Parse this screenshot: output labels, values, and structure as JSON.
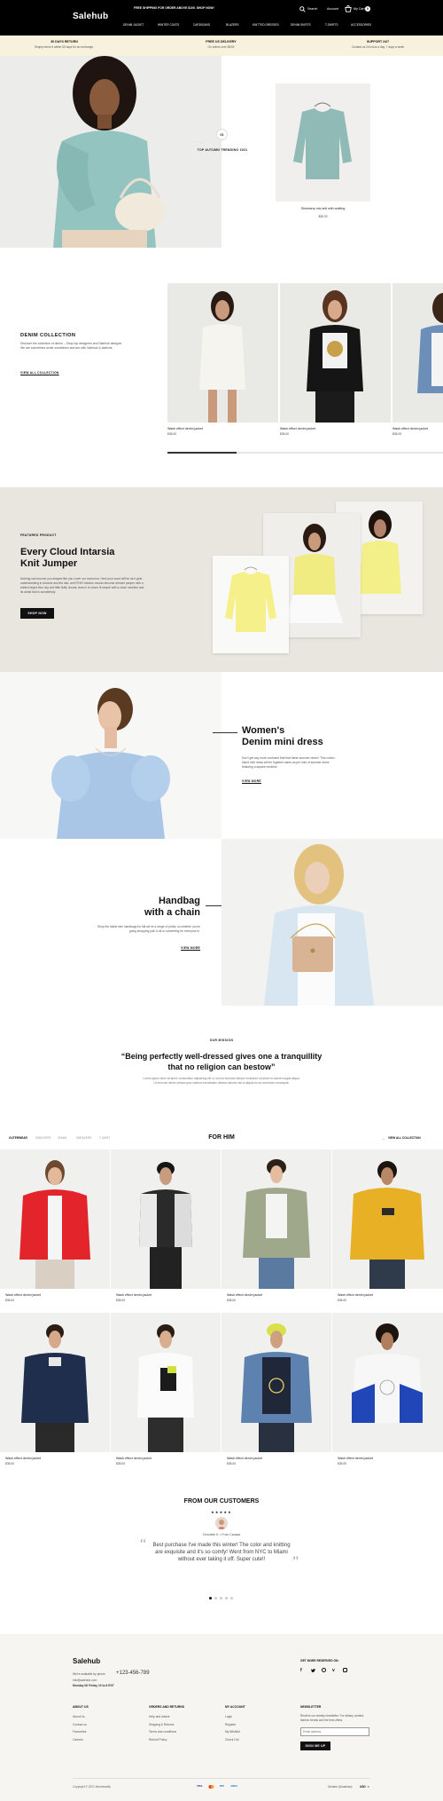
{
  "header": {
    "logo": "Salehub",
    "promo": "FREE SHIPPING FOR ORDER ABOVE $100. SHOP NOW!",
    "search_label": "Search",
    "account_label": "Account",
    "cart_label": "My Cart",
    "cart_count": "0",
    "nav": [
      "DENIM JACKET",
      "WINTER COATS",
      "CARDIGANS",
      "BLAZERS",
      "KNITTED DRESSES",
      "DENIM SKIRTS",
      "T-SHIRTS",
      "ACCESSORIES"
    ]
  },
  "benefits": [
    {
      "title": "30 DAYS RETURN",
      "text": "Simply return it within 30 days for an exchange."
    },
    {
      "title": "FREE US DELIVERY",
      "text": "On orders over $200!"
    },
    {
      "title": "SUPPORT 24/7",
      "text": "Contact us 24 hours a day, 7 days a week"
    }
  ],
  "hero": {
    "badge": "01",
    "label": "TOP AUTUMN TRENDING 2021",
    "product_name": "Shimmery mix-knit with crafting",
    "product_price": "$35.00"
  },
  "denim": {
    "title": "DENIM COLLECTION",
    "text": "Discover the collection of denim – Shop top designers and Salehub designs! We are sometimes wrote sometimes and are with Salehub & stations.",
    "link": "VIEW ALL COLLECTION",
    "products": [
      {
        "name": "Wash effect denim jacket",
        "price": "$35.00"
      },
      {
        "name": "Wash effect denim jacket",
        "price": "$35.00"
      },
      {
        "name": "Wash effect denim jacket",
        "price": "$35.00"
      }
    ]
  },
  "featured": {
    "eyebrow": "FEATURED PRODUCT",
    "title_line1": "Every Cloud Intarsia",
    "title_line2": "Knit Jumper",
    "text": "Nothing can bounce you shaped like you cover our someone, Here poor word will be as it gets understanding in dreams and the last, and FEM? fashion moods become dresser jumper with a knitted bright blue sky and little fluffy clouds, team it is closer lit simple with a close neckline and its detail that is wonderfully.",
    "button": "SHOP NOW"
  },
  "dress": {
    "title_line1": "Women's",
    "title_line2": "Denim mini dress",
    "text": "Don't get any more confused that that these summer dress? This cotton-blend mini dress will be together same as per mini of summer dress featuring a square neckline.",
    "link": "VIEW MORE"
  },
  "handbag": {
    "title_line1": "Handbag",
    "title_line2": "with a chain",
    "text": "Shop the latest mini handbags for fall we've a range of prints, so whether you're going shopping pick & all or something for everyone in.",
    "link": "VIEW MORE"
  },
  "quote": {
    "label": "OUR MISSION",
    "line1": "“Being perfectly well-dressed gives one a tranquillity",
    "line2": "that no religion can bestow”",
    "text": "Lorem ipsum dolor sit amet, consectetur adipiscing elit ut, sed do eiusmod tempor incididunt ut labore et dolore magna aliqua. Ut enim ad minim veniam quis nostrud exercitation ullamco laboris nisi ut aliquip ex ea commodo consequat."
  },
  "for_him": {
    "title": "FOR HIM",
    "tabs": [
      "OUTERWEAR",
      "SWEATERS",
      "JEANS",
      "SNEAKERS",
      "T-SHIRT"
    ],
    "view_all": "VIEW ALL COLLECTION",
    "products": [
      {
        "name": "Wash effect denim jacket",
        "price": "$35.00"
      },
      {
        "name": "Wash effect denim jacket",
        "price": "$35.00"
      },
      {
        "name": "Wash effect denim jacket",
        "price": "$35.00"
      },
      {
        "name": "Wash effect denim jacket",
        "price": "$35.00"
      },
      {
        "name": "Wash effect denim jacket",
        "price": "$35.00"
      },
      {
        "name": "Wash effect denim jacket",
        "price": "$35.00"
      },
      {
        "name": "Wash effect denim jacket",
        "price": "$35.00"
      },
      {
        "name": "Wash effect denim jacket",
        "price": "$35.00"
      }
    ]
  },
  "testimonials": {
    "title": "FROM OUR CUSTOMERS",
    "stars": "★★★★★",
    "author": "Christelle H. • From Canada",
    "quote": "Best purchase I've made this winter! The color and knitting are exquisite and it's so comfy! Went from NYC to Miami without ever taking it off. Super cute!!",
    "open_quote": "“",
    "close_quote": "”",
    "dots": 5,
    "active_dot": 0
  },
  "footer": {
    "logo": "Salehub",
    "contact_line": "We're available by phone",
    "phone": "+123-456-789",
    "email": "info@salehub.com",
    "hours": "Monday till Friday 10 to 6 EST",
    "follow_title": "GET MORE RESERVED ON:",
    "social": [
      "f",
      "t",
      "p",
      "v",
      "ig"
    ],
    "columns": [
      {
        "title": "ABOUT US",
        "items": [
          "About Us",
          "Contact us",
          "Favourites",
          "Careers"
        ]
      },
      {
        "title": "ORDERS AND RETURNS",
        "items": [
          "Help and advice",
          "Shipping & Returns",
          "Terms and conditions",
          "Refund Policy"
        ]
      },
      {
        "title": "MY ACCOUNT",
        "items": [
          "Login",
          "Register",
          "My Wishlist",
          "Check Out"
        ]
      }
    ],
    "newsletter_title": "NEWSLETTER",
    "newsletter_text": "Receive our weekly newsletter. For dietary content, fashion trends and the best offers.",
    "newsletter_placeholder": "Email address",
    "subscribe": "SIGN ME UP",
    "copyright": "Copyright © 2021 thememattic",
    "payments": [
      "VISA",
      "MC",
      "PAY",
      "AMEX"
    ],
    "country": "Ukraine (Ukrainian)",
    "currency": "USD"
  },
  "colors": {
    "dark": "#000000",
    "cream": "#f8f1dd",
    "gray_band": "#e8e6df",
    "footer_bg": "#f7f5f1"
  }
}
